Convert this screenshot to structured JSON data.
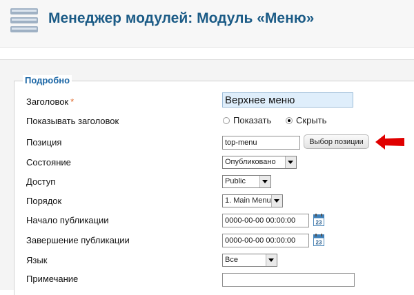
{
  "page": {
    "title": "Менеджер модулей: Модуль «Меню»",
    "icon": "module-manager-icon"
  },
  "fieldset": {
    "legend": "Подробно",
    "fields": {
      "title": {
        "label": "Заголовок",
        "required_mark": "*",
        "value": "Верхнее меню"
      },
      "show_title": {
        "label": "Показывать заголовок",
        "options": [
          "Показать",
          "Скрыть"
        ],
        "selected": "Скрыть"
      },
      "position": {
        "label": "Позиция",
        "value": "top-menu",
        "button_label": "Выбор позиции"
      },
      "state": {
        "label": "Состояние",
        "value": "Опубликовано"
      },
      "access": {
        "label": "Доступ",
        "value": "Public"
      },
      "order": {
        "label": "Порядок",
        "value": "1. Main Menu"
      },
      "publish_up": {
        "label": "Начало публикации",
        "value": "0000-00-00 00:00:00",
        "calendar_icon_text": "23"
      },
      "publish_down": {
        "label": "Завершение публикации",
        "value": "0000-00-00 00:00:00",
        "calendar_icon_text": "23"
      },
      "language": {
        "label": "Язык",
        "value": "Все"
      },
      "note": {
        "label": "Примечание",
        "value": ""
      }
    }
  },
  "colors": {
    "title": "#1b5b86",
    "legend": "#1b66a5",
    "title_input_bg": "#dfeefb",
    "arrow": "#e00000"
  },
  "annotation": {
    "icon": "red-arrow-icon"
  }
}
